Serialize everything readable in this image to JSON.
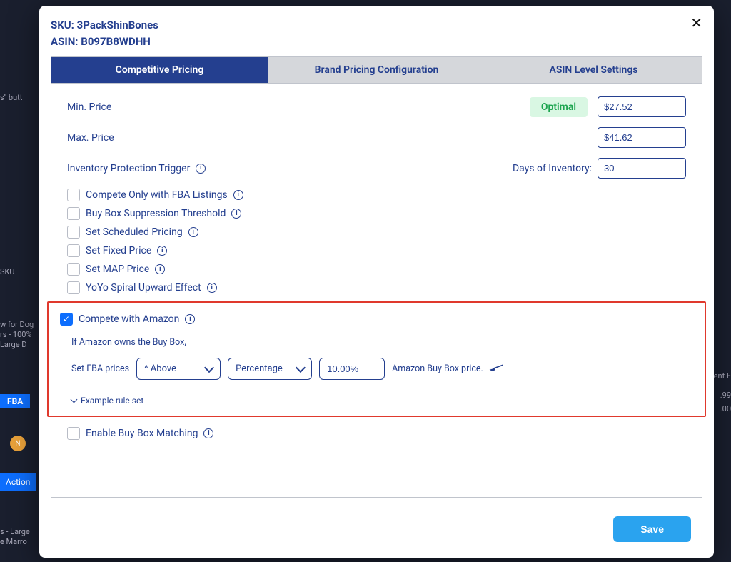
{
  "header": {
    "sku_label": "SKU:",
    "sku_value": "3PackShinBones",
    "asin_label": "ASIN:",
    "asin_value": "B097B8WDHH"
  },
  "tabs": {
    "competitive": "Competitive Pricing",
    "brand": "Brand Pricing Configuration",
    "asin": "ASIN Level Settings"
  },
  "fields": {
    "min_price_label": "Min. Price",
    "optimal_badge": "Optimal",
    "min_price_value": "$27.52",
    "max_price_label": "Max. Price",
    "max_price_value": "$41.62",
    "inv_trigger_label": "Inventory Protection Trigger",
    "days_label": "Days of Inventory:",
    "days_value": "30"
  },
  "options": {
    "compete_fba": "Compete Only with FBA Listings",
    "buybox_suppression": "Buy Box Suppression Threshold",
    "scheduled_pricing": "Set Scheduled Pricing",
    "fixed_price": "Set Fixed Price",
    "map_price": "Set MAP Price",
    "yoyo": "YoYo Spiral Upward Effect",
    "compete_amazon": "Compete with Amazon",
    "enable_bb_matching": "Enable Buy Box Matching"
  },
  "amazon": {
    "intro": "If Amazon owns the Buy Box,",
    "set_fba_label": "Set FBA prices",
    "direction_value": "^ Above",
    "type_value": "Percentage",
    "pct_value": "10.00%",
    "tail": "Amazon Buy Box price.",
    "example": "Example rule set"
  },
  "footer": {
    "save": "Save"
  },
  "bg": {
    "butt": "s\" butt",
    "sku": "SKU",
    "dogs": "w for Dog",
    "hundred": "rs - 100%",
    "large": "Large D",
    "fba": "FBA",
    "n": "N",
    "action": "Action",
    "marrow1": "s - Large",
    "marrow2": "e Marro",
    "rent": "rent F",
    "p99": ".99",
    "p00": ".00"
  }
}
